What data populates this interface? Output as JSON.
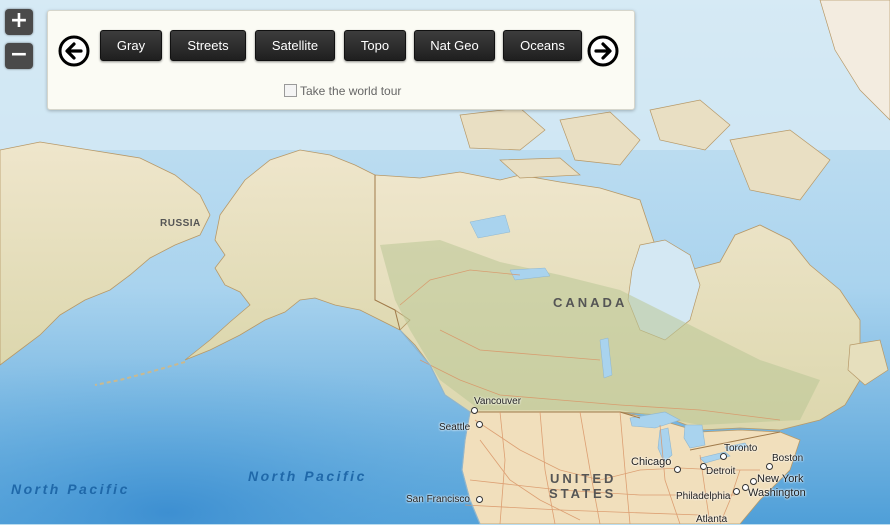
{
  "zoom": {
    "in_label": "+",
    "out_label": "−"
  },
  "panel": {
    "basemaps": [
      "Gray",
      "Streets",
      "Satellite",
      "Topo",
      "Nat Geo",
      "Oceans"
    ],
    "tour_label": "Take the world tour",
    "tour_checked": false
  },
  "labels": {
    "russia": "RUSSIA",
    "canada": "CANADA",
    "united_states_line1": "UNITED",
    "united_states_line2": "STATES",
    "north_pacific_west": "North Pacific",
    "north_pacific_east": "North Pacific"
  },
  "cities": [
    "Vancouver",
    "Seattle",
    "San Francisco",
    "Chicago",
    "Detroit",
    "Toronto",
    "Boston",
    "New York",
    "Philadelphia",
    "Washington",
    "Atlanta"
  ],
  "colors": {
    "ocean_deep": "#5aa8de",
    "ocean_light": "#b9dcef",
    "arctic_water": "#d9ebf5",
    "land_tundra": "#ede2c6",
    "land_forest": "#c9d3a6",
    "usa_land": "#f1dfbc",
    "road": "#d99466",
    "border": "#a07a4a"
  }
}
